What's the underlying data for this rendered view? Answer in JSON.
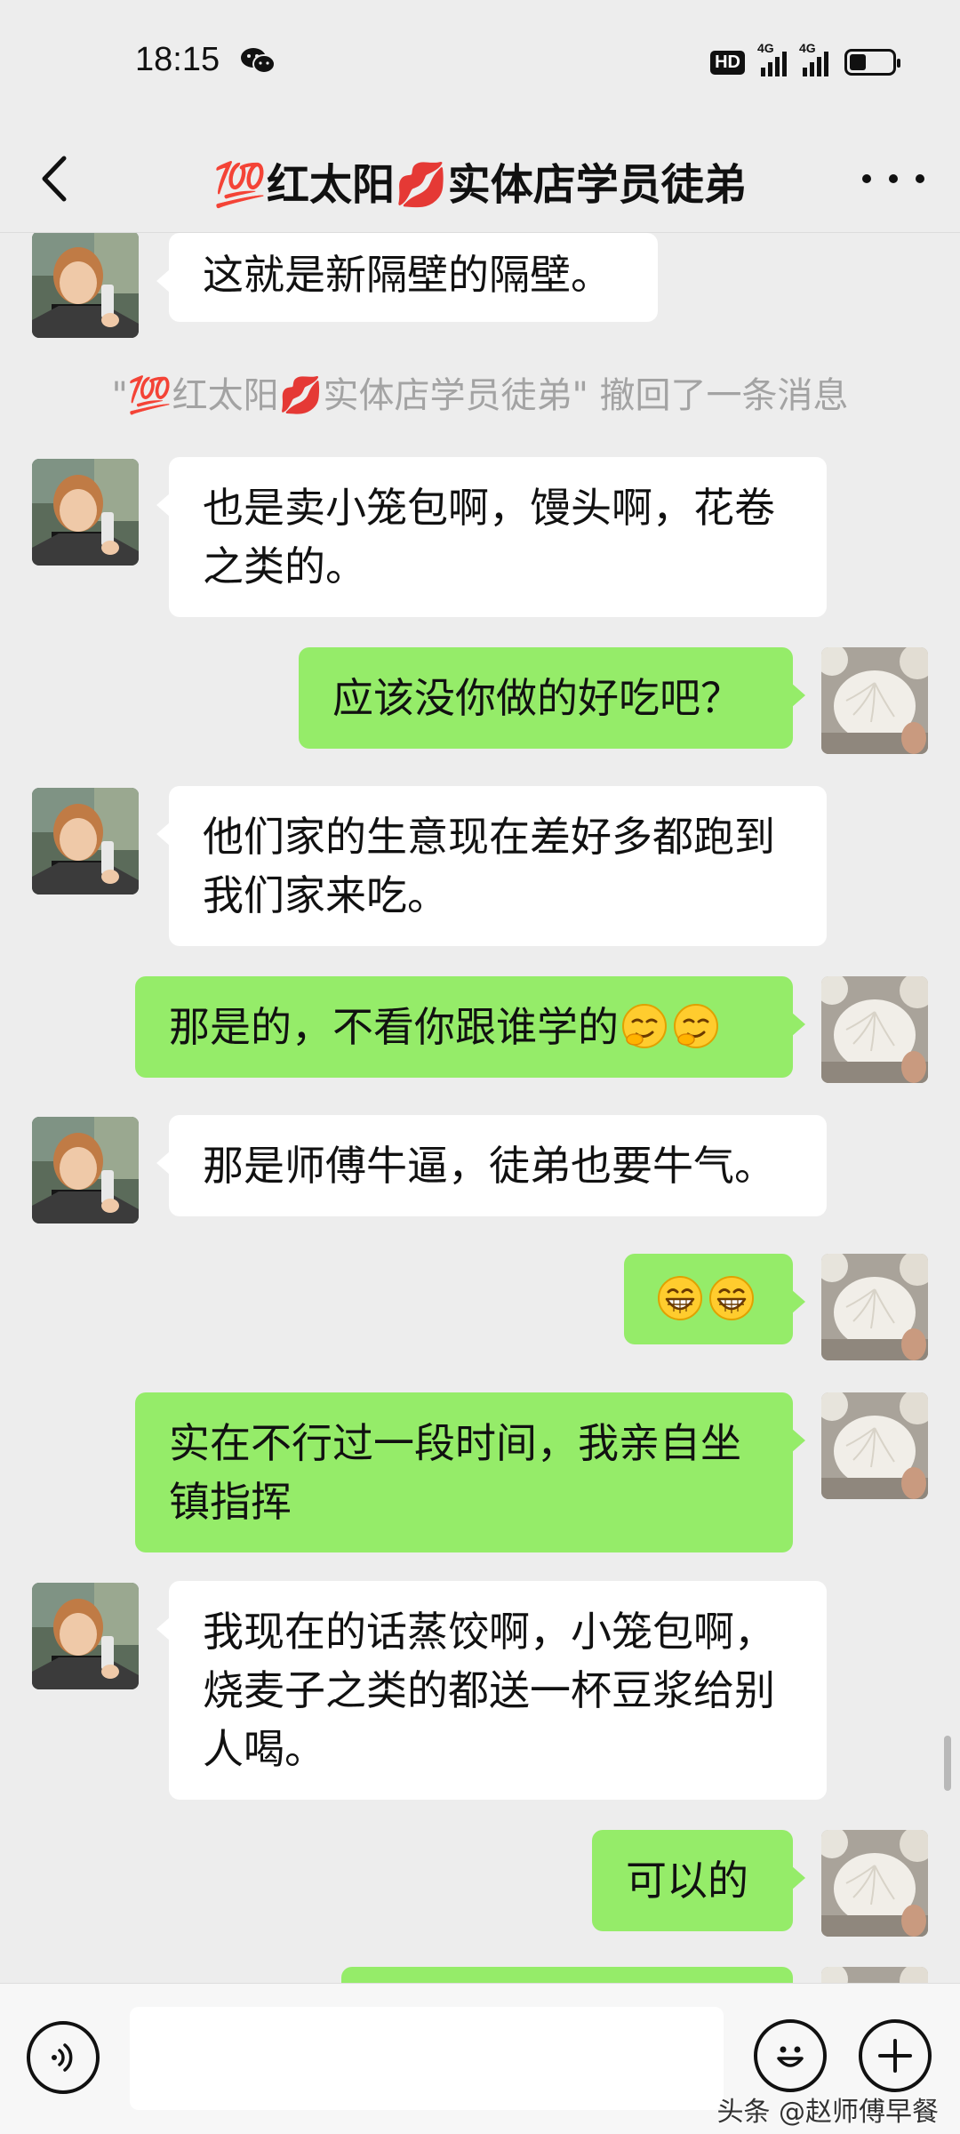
{
  "status_bar": {
    "time": "18:15",
    "hd": "HD",
    "network_1": "4G",
    "network_2": "4G",
    "battery_level": 0.4
  },
  "header": {
    "title": "💯红太阳💋实体店学员徒弟"
  },
  "messages": [
    {
      "side": "in",
      "text": "这就是新隔壁的隔壁。"
    },
    {
      "system": "\"💯红太阳💋实体店学员徒弟\" 撤回了一条消息"
    },
    {
      "side": "in",
      "text": "也是卖小笼包啊，馒头啊，花卷之类的。"
    },
    {
      "side": "out",
      "text": "应该没你做的好吃吧？"
    },
    {
      "side": "in",
      "text": "他们家的生意现在差好多都跑到我们家来吃。"
    },
    {
      "side": "out",
      "text": "那是的，不看你跟谁学的",
      "emojis": [
        "smirk-emoji",
        "smirk-emoji"
      ]
    },
    {
      "side": "in",
      "text": "那是师傅牛逼，徒弟也要牛气。"
    },
    {
      "side": "out",
      "text": "",
      "emojis": [
        "grin-emoji",
        "grin-emoji"
      ]
    },
    {
      "side": "out",
      "text": "实在不行过一段时间，我亲自坐镇指挥"
    },
    {
      "side": "in",
      "text": "我现在的话蒸饺啊，小笼包啊，烧麦子之类的都送一杯豆浆给别人喝。"
    },
    {
      "side": "out",
      "text": "可以的"
    }
  ],
  "input": {
    "value": "",
    "placeholder": ""
  },
  "icons": {
    "back": "back-arrow-icon",
    "more": "more-dots-icon",
    "voice": "voice-icon",
    "emoji": "emoji-icon",
    "plus": "plus-icon"
  },
  "colors": {
    "background": "#ededed",
    "incoming_bubble": "#ffffff",
    "outgoing_bubble": "#95ec69",
    "system_text": "#a3a3a3"
  },
  "watermark": "头条 @赵师傅早餐"
}
